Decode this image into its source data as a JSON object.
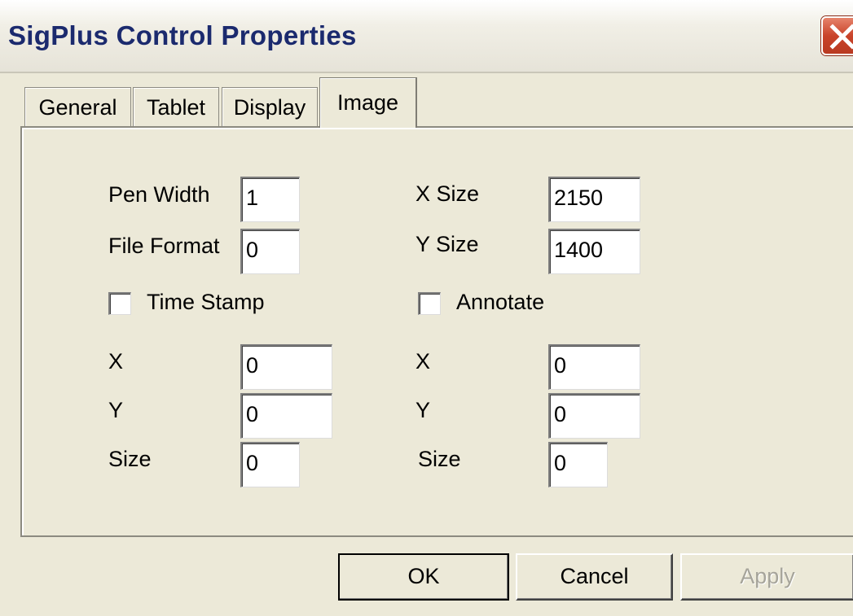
{
  "window": {
    "title": "SigPlus Control Properties",
    "close_icon": "close-icon"
  },
  "tabs": [
    {
      "label": "General",
      "active": false
    },
    {
      "label": "Tablet",
      "active": false
    },
    {
      "label": "Display",
      "active": false
    },
    {
      "label": "Image",
      "active": true
    }
  ],
  "image_tab": {
    "pen_width": {
      "label": "Pen Width",
      "value": "1"
    },
    "file_format": {
      "label": "File Format",
      "value": "0"
    },
    "x_size": {
      "label": "X Size",
      "value": "2150"
    },
    "y_size": {
      "label": "Y Size",
      "value": "1400"
    },
    "time_stamp": {
      "label": "Time Stamp",
      "checked": false,
      "x": {
        "label": "X",
        "value": "0"
      },
      "y": {
        "label": "Y",
        "value": "0"
      },
      "size": {
        "label": "Size",
        "value": "0"
      }
    },
    "annotate": {
      "label": "Annotate",
      "checked": false,
      "x": {
        "label": "X",
        "value": "0"
      },
      "y": {
        "label": "Y",
        "value": "0"
      },
      "size": {
        "label": "Size",
        "value": "0"
      }
    }
  },
  "buttons": {
    "ok": "OK",
    "cancel": "Cancel",
    "apply": "Apply"
  },
  "colors": {
    "title_text": "#1b2a6e",
    "close_red": "#c9432a",
    "dialog_bg": "#ece9d8"
  }
}
